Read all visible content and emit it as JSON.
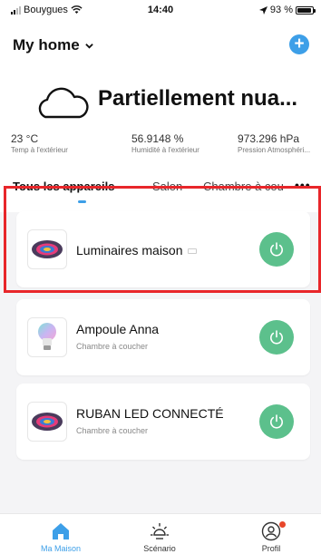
{
  "status_bar": {
    "carrier": "Bouygues",
    "time": "14:40",
    "battery": "93 %"
  },
  "header": {
    "home_name": "My home"
  },
  "weather": {
    "condition": "Partiellement nua...",
    "metrics": [
      {
        "value": "23 °C",
        "label": "Temp à l'extérieur"
      },
      {
        "value": "56.9148 %",
        "label": "Humidité à l'extérieur"
      },
      {
        "value": "973.296 hPa",
        "label": "Pression Atmosphéri..."
      }
    ]
  },
  "tabs": [
    {
      "label": "Tous les appareils"
    },
    {
      "label": "Salon"
    },
    {
      "label": "Chambre à cou"
    }
  ],
  "more_label": "•••",
  "devices": [
    {
      "name": "Luminaires maison",
      "subtitle": ""
    },
    {
      "name": "Ampoule Anna",
      "subtitle": "Chambre à coucher"
    },
    {
      "name": "RUBAN LED CONNECTÉ",
      "subtitle": "Chambre à coucher"
    }
  ],
  "bottom_nav": [
    {
      "label": "Ma Maison",
      "icon": "home-icon"
    },
    {
      "label": "Scénario",
      "icon": "sun-icon"
    },
    {
      "label": "Profil",
      "icon": "profile-icon"
    }
  ],
  "colors": {
    "accent": "#3d9fe8",
    "power_on": "#5cc08c",
    "highlight": "#e8262a"
  }
}
